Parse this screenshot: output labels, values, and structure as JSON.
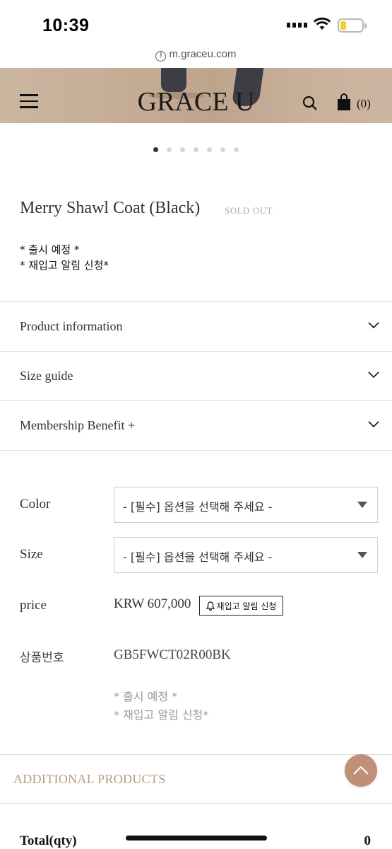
{
  "status": {
    "time": "10:39"
  },
  "browser": {
    "url": "m.graceu.com",
    "info_glyph": "!"
  },
  "header": {
    "logo": "GRACE U",
    "cart_count": "(0)"
  },
  "carousel": {
    "total": 7,
    "active": 1
  },
  "product": {
    "title": "Merry Shawl Coat (Black)",
    "status": "SOLD OUT",
    "notes": [
      "* 출시 예정 *",
      "* 재입고 알림 신청*"
    ]
  },
  "accordion": [
    {
      "label": "Product information"
    },
    {
      "label": "Size guide"
    },
    {
      "label": "Membership Benefit +"
    }
  ],
  "options": {
    "color": {
      "label": "Color",
      "value": "- [필수] 옵션을 선택해 주세요 -"
    },
    "size": {
      "label": "Size",
      "value": "- [필수] 옵션을 선택해 주세요 -"
    }
  },
  "price": {
    "label": "price",
    "value": "KRW 607,000",
    "restock_button": "재입고 알림 신청"
  },
  "product_code": {
    "label": "상품번호",
    "value": "GB5FWCT02R00BK"
  },
  "option_notes": [
    "* 출시 예정 *",
    "* 재입고 알림 신청*"
  ],
  "additional": {
    "label": "ADDITIONAL PRODUCTS"
  },
  "total": {
    "label": "Total(qty)",
    "value": "0"
  },
  "colors": {
    "accent": "#c08f78",
    "soldout": "#b7a89a",
    "additional": "#b39c86"
  }
}
